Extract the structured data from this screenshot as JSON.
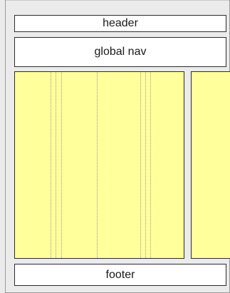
{
  "layout": {
    "header": {
      "label": "header"
    },
    "global_nav": {
      "label": "global nav"
    },
    "footer": {
      "label": "footer"
    }
  },
  "colors": {
    "background": "#ebebeb",
    "box_fill": "#ffffff",
    "column_fill": "#ffff9b",
    "border": "#2c2c2c",
    "grid_line": "#9d9d9d"
  }
}
